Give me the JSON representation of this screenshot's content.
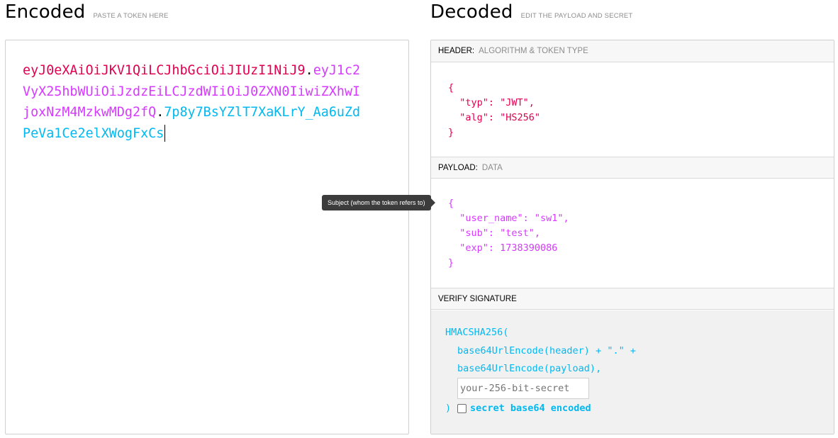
{
  "encoded": {
    "title": "Encoded",
    "subtitle": "PASTE A TOKEN HERE",
    "token_header": "eyJ0eXAiOiJKV1QiLCJhbGciOiJIUzI1NiJ9",
    "token_payload": "eyJ1c2VyX25hbWUiOiJzdzEiLCJzdWIiOiJ0ZXN0IiwiZXhwIjoxNzM4MzkwMDg2fQ",
    "token_signature": "7p8y7BsYZlT7XaKLrY_Aa6uZdPeVa1Ce2elXWogFxCs",
    "separator": "."
  },
  "decoded": {
    "title": "Decoded",
    "subtitle": "EDIT THE PAYLOAD AND SECRET",
    "header_section": {
      "label": "HEADER:",
      "sub": "ALGORITHM & TOKEN TYPE",
      "json": "{\n  \"typ\": \"JWT\",\n  \"alg\": \"HS256\"\n}"
    },
    "payload_section": {
      "label": "PAYLOAD:",
      "sub": "DATA",
      "json": "{\n  \"user_name\": \"sw1\",\n  \"sub\": \"test\",\n  \"exp\": 1738390086\n}"
    },
    "verify_section": {
      "label": "VERIFY SIGNATURE",
      "line1": "HMACSHA256(",
      "line2": "base64UrlEncode(header) + \".\" +",
      "line3": "base64UrlEncode(payload),",
      "secret_placeholder": "your-256-bit-secret",
      "close": ")",
      "checkbox_label": "secret base64 encoded",
      "checkbox_checked": false
    }
  },
  "tooltip": "Subject (whom the token refers to)",
  "colors": {
    "header": "#e1004f",
    "payload": "#d63aff",
    "signature": "#00b9f1"
  }
}
